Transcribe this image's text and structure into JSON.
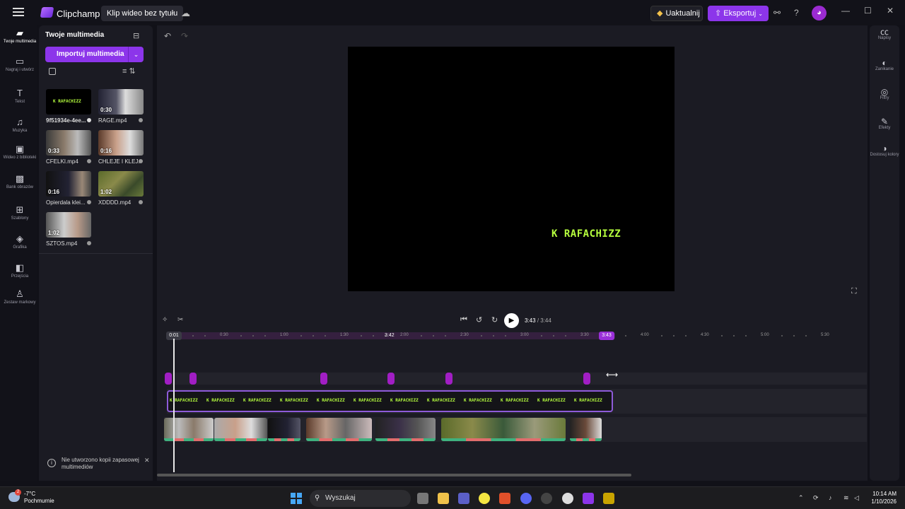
{
  "titlebar": {
    "app_name": "Clipchamp",
    "project_title": "Klip wideo bez tytułu",
    "upgrade_label": "Uaktualnij",
    "export_label": "Eksportuj",
    "help": "?"
  },
  "rail": {
    "items": [
      {
        "label": "Twoje multimedia",
        "icon": "folder-icon"
      },
      {
        "label": "Nagraj i utwórz",
        "icon": "camera-icon"
      },
      {
        "label": "Tekst",
        "icon": "text-icon"
      },
      {
        "label": "Muzyka",
        "icon": "music-icon"
      },
      {
        "label": "Wideo z biblioteki",
        "icon": "film-icon"
      },
      {
        "label": "Bank obrazów",
        "icon": "image-icon"
      },
      {
        "label": "Szablony",
        "icon": "grid-icon"
      },
      {
        "label": "Grafika",
        "icon": "shapes-icon"
      },
      {
        "label": "Przejścia",
        "icon": "transition-icon"
      },
      {
        "label": "Zestaw markowy",
        "icon": "brand-icon"
      }
    ]
  },
  "media": {
    "title": "Twoje multimedia",
    "import_label": "Importuj multimedia",
    "items": [
      {
        "name": "9f51934e-4ee...",
        "duration": ""
      },
      {
        "name": "RAGE.mp4",
        "duration": "0:30"
      },
      {
        "name": "CFELKI.mp4",
        "duration": "0:33"
      },
      {
        "name": "CHLEJE I KLEJ...",
        "duration": "0:16"
      },
      {
        "name": "Opierdala klei...",
        "duration": "0:16"
      },
      {
        "name": "XDDDD.mp4",
        "duration": "1:02"
      },
      {
        "name": "SZTOS.mp4",
        "duration": "1:02"
      }
    ],
    "thumb_text": "K RAFACHIZZ",
    "notice": "Nie utworzono kopii zapasowej multimediów"
  },
  "preview": {
    "overlay_text": "K RAFACHIZZ"
  },
  "right_panel": {
    "items": [
      {
        "label": "Napisy",
        "icon": "captions-icon"
      },
      {
        "label": "Zanikanie",
        "icon": "fade-icon"
      },
      {
        "label": "Filtry",
        "icon": "filters-icon"
      },
      {
        "label": "Efekty",
        "icon": "effects-icon"
      },
      {
        "label": "Dostosuj kolory",
        "icon": "color-icon"
      }
    ]
  },
  "playback": {
    "current": "3:43",
    "total": "/ 3:44"
  },
  "timeline": {
    "ruler": [
      "0:30",
      "1:00",
      "1:30",
      "2:00",
      "2:30",
      "3:00",
      "3:30",
      "4:00",
      "4:30",
      "5:00",
      "5:30"
    ],
    "cursor_start": "0:01",
    "cursor_end": "3:43",
    "hover_time": "3:42",
    "text_clip": "K RAFACHIZZ"
  },
  "taskbar": {
    "temperature": "-7°C",
    "weather": "Pochmurnie",
    "weather_badge": "2",
    "search_placeholder": "Wyszukaj",
    "time": "10:14 AM",
    "date": "1/10/2026"
  },
  "colors": {
    "accent": "#8c35ea",
    "overlay_text": "#b6ff3e",
    "marker": "#a11ec4"
  }
}
